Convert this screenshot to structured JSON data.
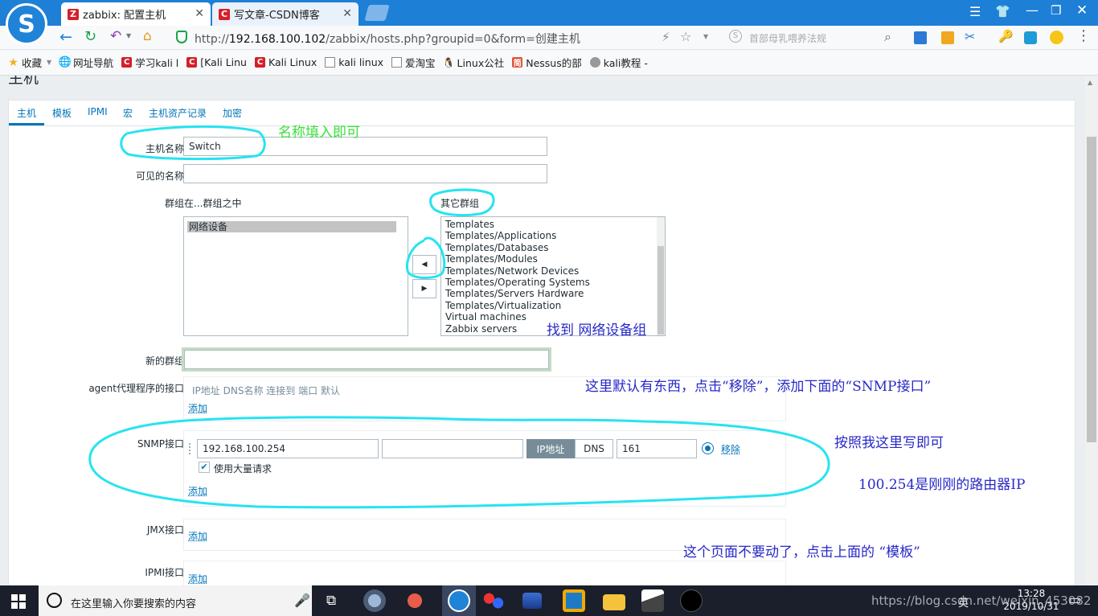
{
  "browser": {
    "tabs": [
      {
        "label": "zabbix: 配置主机",
        "favicon": "Z",
        "active": true
      },
      {
        "label": "写文章-CSDN博客",
        "favicon": "C",
        "active": false
      }
    ],
    "url_prefix": "http://",
    "url_host": "192.168.100.102",
    "url_path": "/zabbix/hosts.php?groupid=0&form=创建主机",
    "search_placeholder": "首部母乳喂养法规",
    "bookmarks": [
      {
        "label": "收藏",
        "icon": "star-icon"
      },
      {
        "label": "网址导航",
        "icon": "globe-icon"
      },
      {
        "label": "学习kali l",
        "icon": "csdn-icon"
      },
      {
        "label": "[Kali Linu",
        "icon": "csdn-icon"
      },
      {
        "label": "Kali Linux",
        "icon": "csdn-icon"
      },
      {
        "label": "kali linux",
        "icon": "page-icon"
      },
      {
        "label": "爱淘宝",
        "icon": "page-icon"
      },
      {
        "label": "Linux公社",
        "icon": "penguin-icon"
      },
      {
        "label": "Nessus的部",
        "icon": "jian-icon"
      },
      {
        "label": "kali教程 -",
        "icon": "circle-icon"
      }
    ]
  },
  "page": {
    "heading": "主机",
    "tabs": [
      "主机",
      "模板",
      "IPMI",
      "宏",
      "主机资产记录",
      "加密"
    ],
    "form": {
      "host_name_label": "主机名称",
      "host_name_value": "Switch",
      "visible_name_label": "可见的名称",
      "groups_label": "群组",
      "in_groups_label": "在...群组之中",
      "other_groups_label": "其它群组",
      "in_groups": [
        "网络设备"
      ],
      "other_groups": [
        "Templates",
        "Templates/Applications",
        "Templates/Databases",
        "Templates/Modules",
        "Templates/Network Devices",
        "Templates/Operating Systems",
        "Templates/Servers Hardware",
        "Templates/Virtualization",
        "Virtual machines",
        "Zabbix servers"
      ],
      "new_group_label": "新的群组",
      "agent_label": "agent代理程序的接口",
      "agent_columns": [
        "IP地址",
        "DNS名称",
        "连接到",
        "端口",
        "默认"
      ],
      "add_label": "添加",
      "snmp_label": "SNMP接口",
      "snmp_ip": "192.168.100.254",
      "snmp_dns": "",
      "snmp_connect_ip": "IP地址",
      "snmp_connect_dns": "DNS",
      "snmp_port": "161",
      "remove_label": "移除",
      "bulk_label": "使用大量请求",
      "jmx_label": "JMX接口",
      "ipmi_label": "IPMI接口"
    }
  },
  "annotations": {
    "name_hint": "名称填入即可",
    "find_group": "找到   网络设备组",
    "agent_hint": "这里默认有东西，点击“移除”，添加下面的“SNMP接口”",
    "snmp_hint": "按照我这里写即可",
    "ip_hint": "100.254是刚刚的路由器IP",
    "template_hint": "这个页面不要动了，点击上面的 “模板”"
  },
  "taskbar": {
    "search_placeholder": "在这里输入你要搜索的内容",
    "time": "13:28",
    "date": "2019/10/31",
    "lang": "英",
    "watermark": "https://blog.csdn.net/weixin_45308292"
  },
  "colors": {
    "tabbar": "#1e7fd6",
    "annotation_circle": "#27e3f0",
    "annotation_text": "#2828c8",
    "zabbix_link": "#0275b8"
  }
}
